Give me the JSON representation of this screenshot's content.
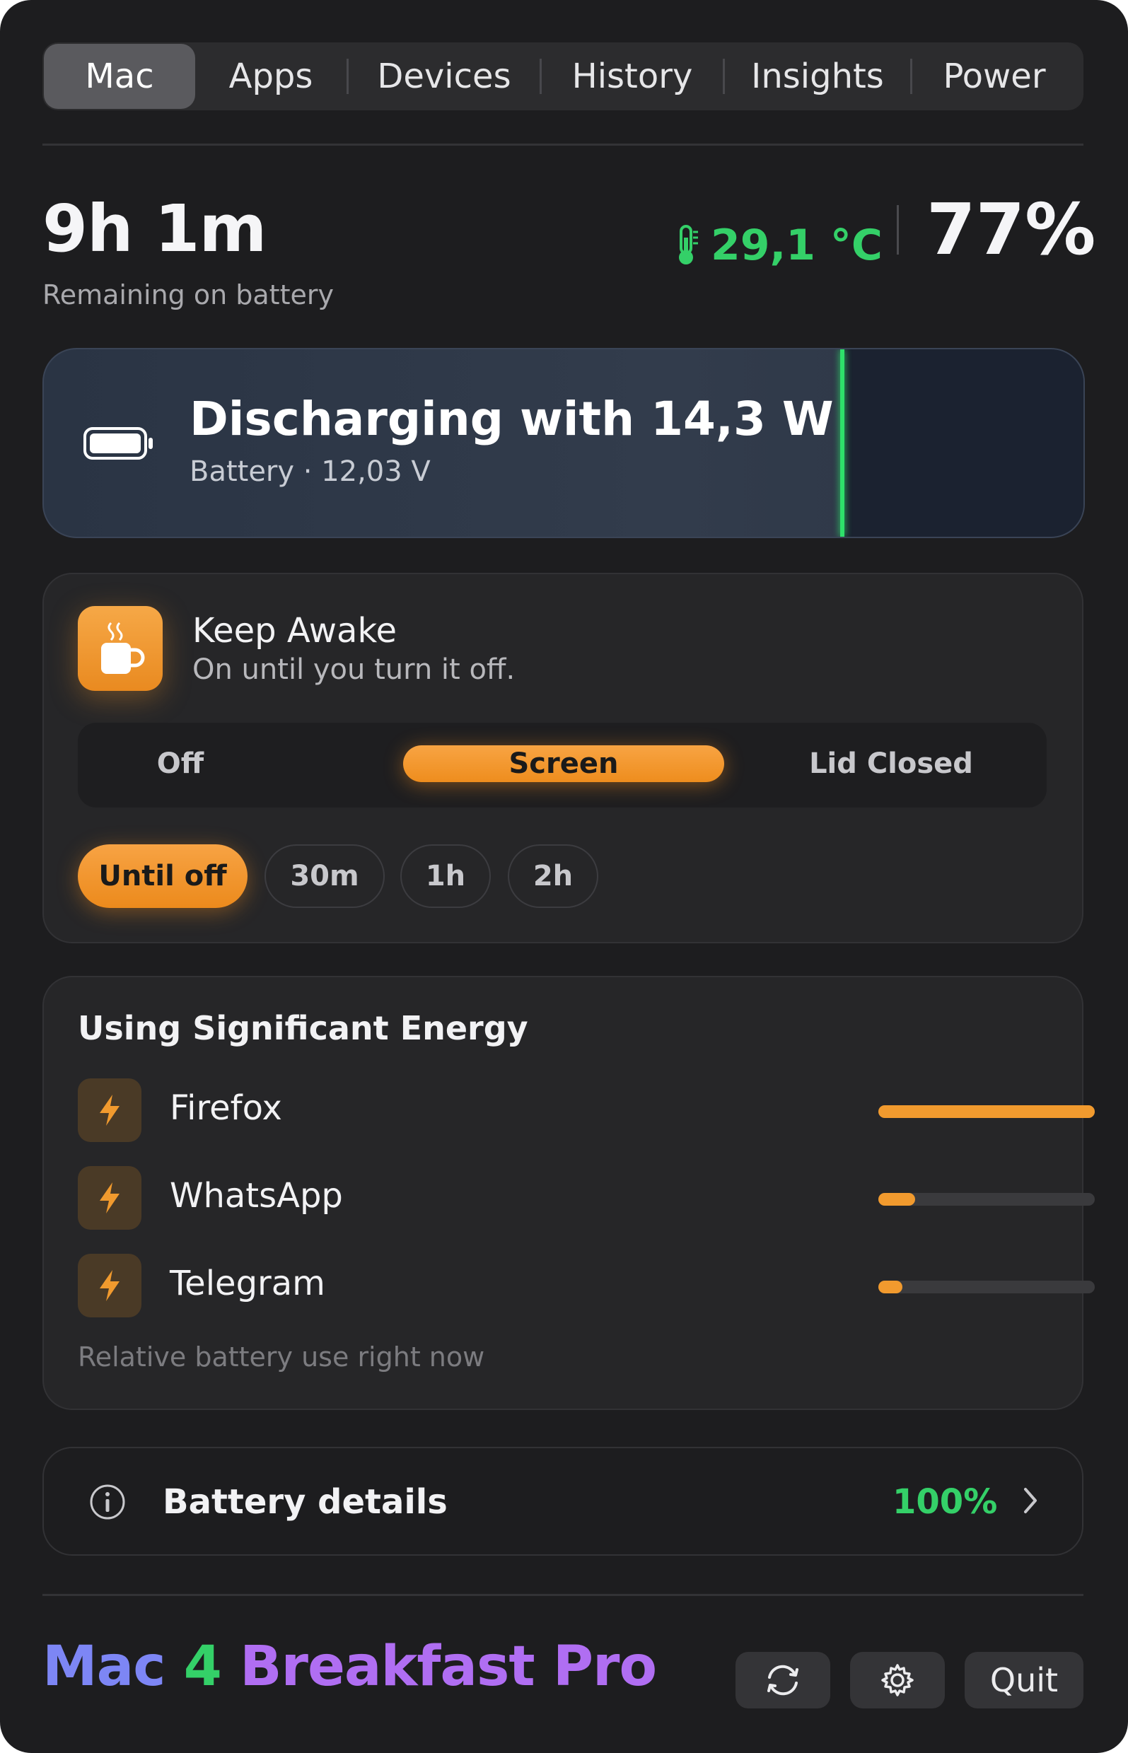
{
  "tabs": [
    {
      "label": "Mac",
      "active": true
    },
    {
      "label": "Apps"
    },
    {
      "label": "Devices"
    },
    {
      "label": "History"
    },
    {
      "label": "Insights"
    },
    {
      "label": "Power"
    }
  ],
  "summary": {
    "remaining_time": "9h 1m",
    "remaining_label": "Remaining on battery",
    "temperature": "29,1 °C",
    "percent": "77%",
    "battery_level_fraction": 0.77,
    "temperature_color": "#34d068"
  },
  "discharge": {
    "title": "Discharging with 14,3 W",
    "subtitle": "Battery · 12,03 V",
    "level_color": "#2ee06a"
  },
  "keep_awake": {
    "title": "Keep Awake",
    "subtitle": "On until you turn it off.",
    "modes": [
      "Off",
      "Screen",
      "Lid Closed"
    ],
    "selected_mode": "Screen",
    "durations": [
      "Until off",
      "30m",
      "1h",
      "2h"
    ],
    "selected_duration": "Until off",
    "accent": "#f19a2e"
  },
  "energy": {
    "title": "Using Significant Energy",
    "apps": [
      {
        "name": "Firefox",
        "usage_fraction": 1.0
      },
      {
        "name": "WhatsApp",
        "usage_fraction": 0.17
      },
      {
        "name": "Telegram",
        "usage_fraction": 0.11
      }
    ],
    "footnote": "Relative battery use right now"
  },
  "battery_details": {
    "label": "Battery details",
    "value": "100%"
  },
  "footer": {
    "brand_part1": "Mac",
    "brand_part2": "4",
    "brand_part3": "Breakfast Pro",
    "quit_label": "Quit"
  }
}
